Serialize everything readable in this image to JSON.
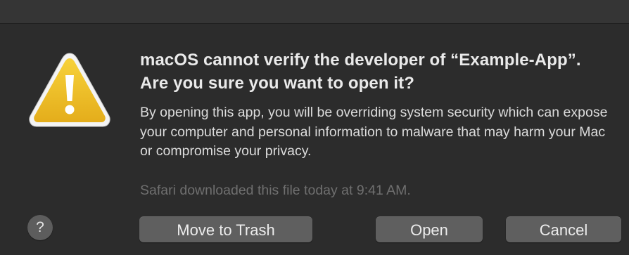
{
  "dialog": {
    "heading": "macOS cannot verify the developer of “Example-App”. Are you sure you want to open it?",
    "message": "By opening this app, you will be overriding system security which can expose your computer and personal information to malware that may harm your Mac or compromise your privacy.",
    "download_note": "Safari downloaded this file today at 9:41 AM."
  },
  "icons": {
    "warning": "warning-triangle-icon",
    "help": "question-mark-icon"
  },
  "buttons": {
    "help_label": "?",
    "move_to_trash": "Move to Trash",
    "open": "Open",
    "cancel": "Cancel"
  },
  "colors": {
    "background": "#2c2c2c",
    "warning_yellow": "#f0c229",
    "button_gray": "#5f5f5f"
  }
}
